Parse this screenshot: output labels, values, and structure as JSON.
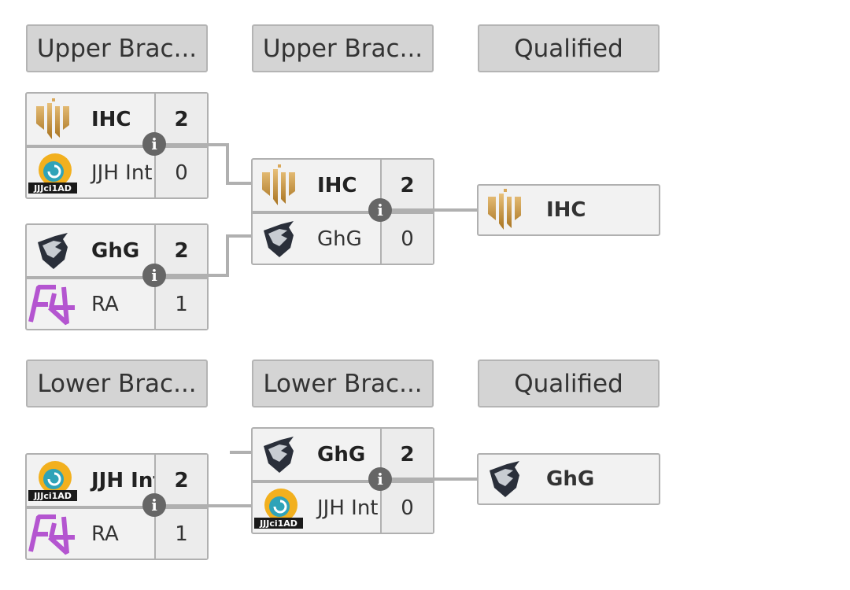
{
  "headers": [
    {
      "label": "Upper Brac..."
    },
    {
      "label": "Upper Brac..."
    },
    {
      "label": "Qualified"
    },
    {
      "label": "Lower Brac..."
    },
    {
      "label": "Lower Brac..."
    },
    {
      "label": "Qualified"
    }
  ],
  "matches": [
    {
      "id": "ub-r1-m1",
      "teams": [
        {
          "name": "IHC",
          "logo": "ihc",
          "score": "2",
          "winner": true
        },
        {
          "name": "JJH Int",
          "logo": "jjh",
          "score": "0",
          "winner": false
        }
      ]
    },
    {
      "id": "ub-r1-m2",
      "teams": [
        {
          "name": "GhG",
          "logo": "ghg",
          "score": "2",
          "winner": true
        },
        {
          "name": "RA",
          "logo": "ra",
          "score": "1",
          "winner": false
        }
      ]
    },
    {
      "id": "ub-r2",
      "teams": [
        {
          "name": "IHC",
          "logo": "ihc",
          "score": "2",
          "winner": true
        },
        {
          "name": "GhG",
          "logo": "ghg",
          "score": "0",
          "winner": false
        }
      ]
    },
    {
      "id": "lb-r2",
      "teams": [
        {
          "name": "GhG",
          "logo": "ghg",
          "score": "2",
          "winner": true
        },
        {
          "name": "JJH Int",
          "logo": "jjh",
          "score": "0",
          "winner": false
        }
      ]
    },
    {
      "id": "lb-r1",
      "teams": [
        {
          "name": "JJH Int",
          "logo": "jjh",
          "score": "2",
          "winner": true
        },
        {
          "name": "RA",
          "logo": "ra",
          "score": "1",
          "winner": false
        }
      ]
    }
  ],
  "qualified": [
    {
      "name": "IHC",
      "logo": "ihc"
    },
    {
      "name": "GhG",
      "logo": "ghg"
    }
  ],
  "info_icon": "info-icon",
  "colors": {
    "header_bg": "#d4d4d4",
    "cell_bg": "#f2f2f2",
    "border": "#b0b0b0",
    "info": "#666666",
    "ra": "#b455d0",
    "ihc": "#c9953f"
  }
}
